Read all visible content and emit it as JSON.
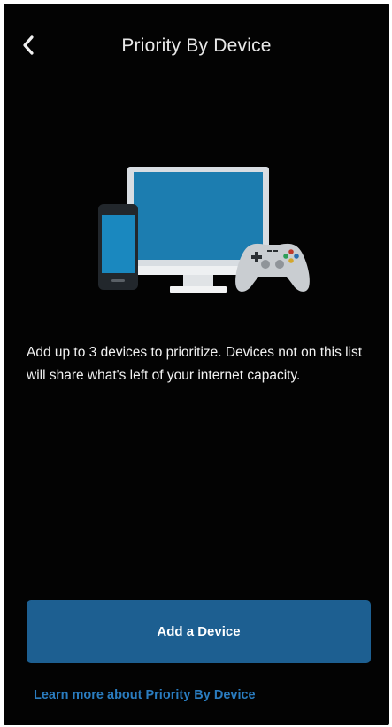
{
  "header": {
    "title": "Priority By Device",
    "back_icon": "chevron-left-icon"
  },
  "illustration": {
    "icons": [
      "smartphone-icon",
      "monitor-icon",
      "game-controller-icon"
    ]
  },
  "description": "Add up to 3 devices to prioritize. Devices not on this list will share what's left of your internet capacity.",
  "actions": {
    "add_device_label": "Add a Device",
    "learn_more_label": "Learn more about Priority By Device"
  },
  "colors": {
    "background": "#030303",
    "primary_button": "#1d5f91",
    "link": "#2a7cbf",
    "text": "#f2f2f2"
  }
}
